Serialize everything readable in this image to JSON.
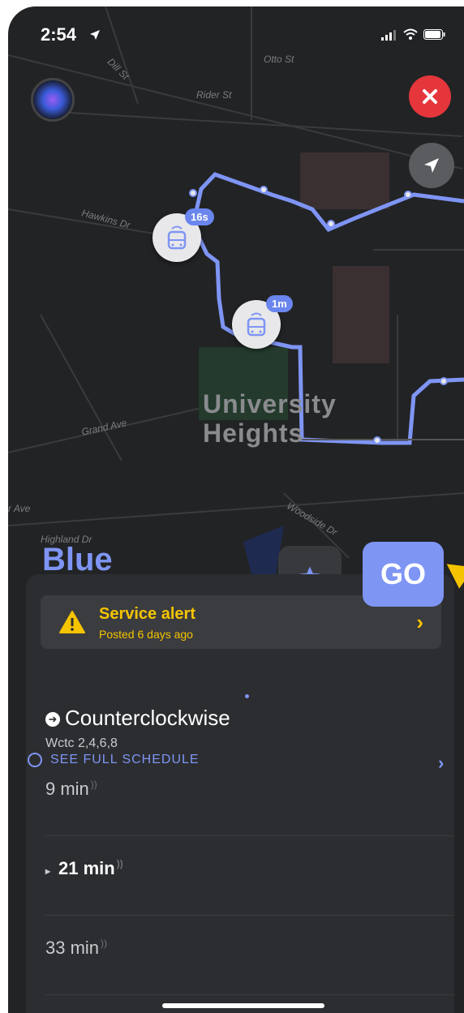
{
  "status_bar": {
    "time": "2:54"
  },
  "map": {
    "area_label_line1": "Univer",
    "area_label_line2": "Heights",
    "area_label_line1_rest": "sity",
    "streets": [
      "Otto St",
      "Rider St",
      "Dill St",
      "Hawkins Dr",
      "Grand Ave",
      "Woodside Dr",
      "Highland Dr",
      "r Ave"
    ],
    "buses": [
      {
        "badge": "16s",
        "icon": "bus-icon"
      },
      {
        "badge": "1m",
        "icon": "bus-icon"
      }
    ],
    "accent_color": "#7e95f4"
  },
  "route": {
    "name": "Blue",
    "go_label": "GO",
    "favorite_icon": "star-icon"
  },
  "alert": {
    "title": "Service alert",
    "posted": "Posted 6 days ago",
    "color": "#f5c400"
  },
  "direction": {
    "label": "Counterclockwise",
    "code": "Wctc 2,4,6,8"
  },
  "arrivals": [
    "9 min",
    "21 min",
    "33 min"
  ],
  "schedule": {
    "label": "SEE FULL SCHEDULE"
  }
}
